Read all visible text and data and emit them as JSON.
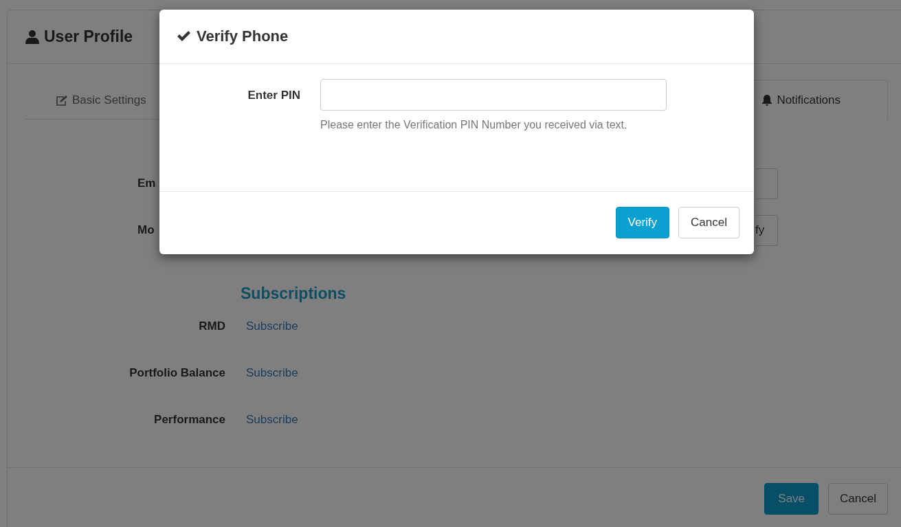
{
  "page": {
    "title": "User Profile"
  },
  "tabs": [
    {
      "label": "Basic Settings",
      "selected": false
    },
    {
      "label": "Notifications",
      "selected": true
    }
  ],
  "fields": [
    {
      "label": "Em",
      "kind": "input"
    },
    {
      "label": "Mo",
      "kind": "button",
      "button": "fy"
    }
  ],
  "subscriptions": {
    "heading": "Subscriptions",
    "rows": [
      {
        "label": "RMD",
        "link": "Subscribe"
      },
      {
        "label": "Portfolio Balance",
        "link": "Subscribe"
      },
      {
        "label": "Performance",
        "link": "Subscribe"
      }
    ]
  },
  "footer": {
    "buttons": [
      {
        "label": "Save",
        "kind": "primary"
      },
      {
        "label": "Cancel",
        "kind": "default"
      }
    ]
  },
  "modal": {
    "title": "Verify Phone",
    "field": {
      "label": "Enter PIN",
      "help": "Please enter the Verification PIN Number you received via text."
    },
    "buttons": [
      {
        "label": "Verify",
        "kind": "primary"
      },
      {
        "label": "Cancel",
        "kind": "default"
      }
    ]
  }
}
